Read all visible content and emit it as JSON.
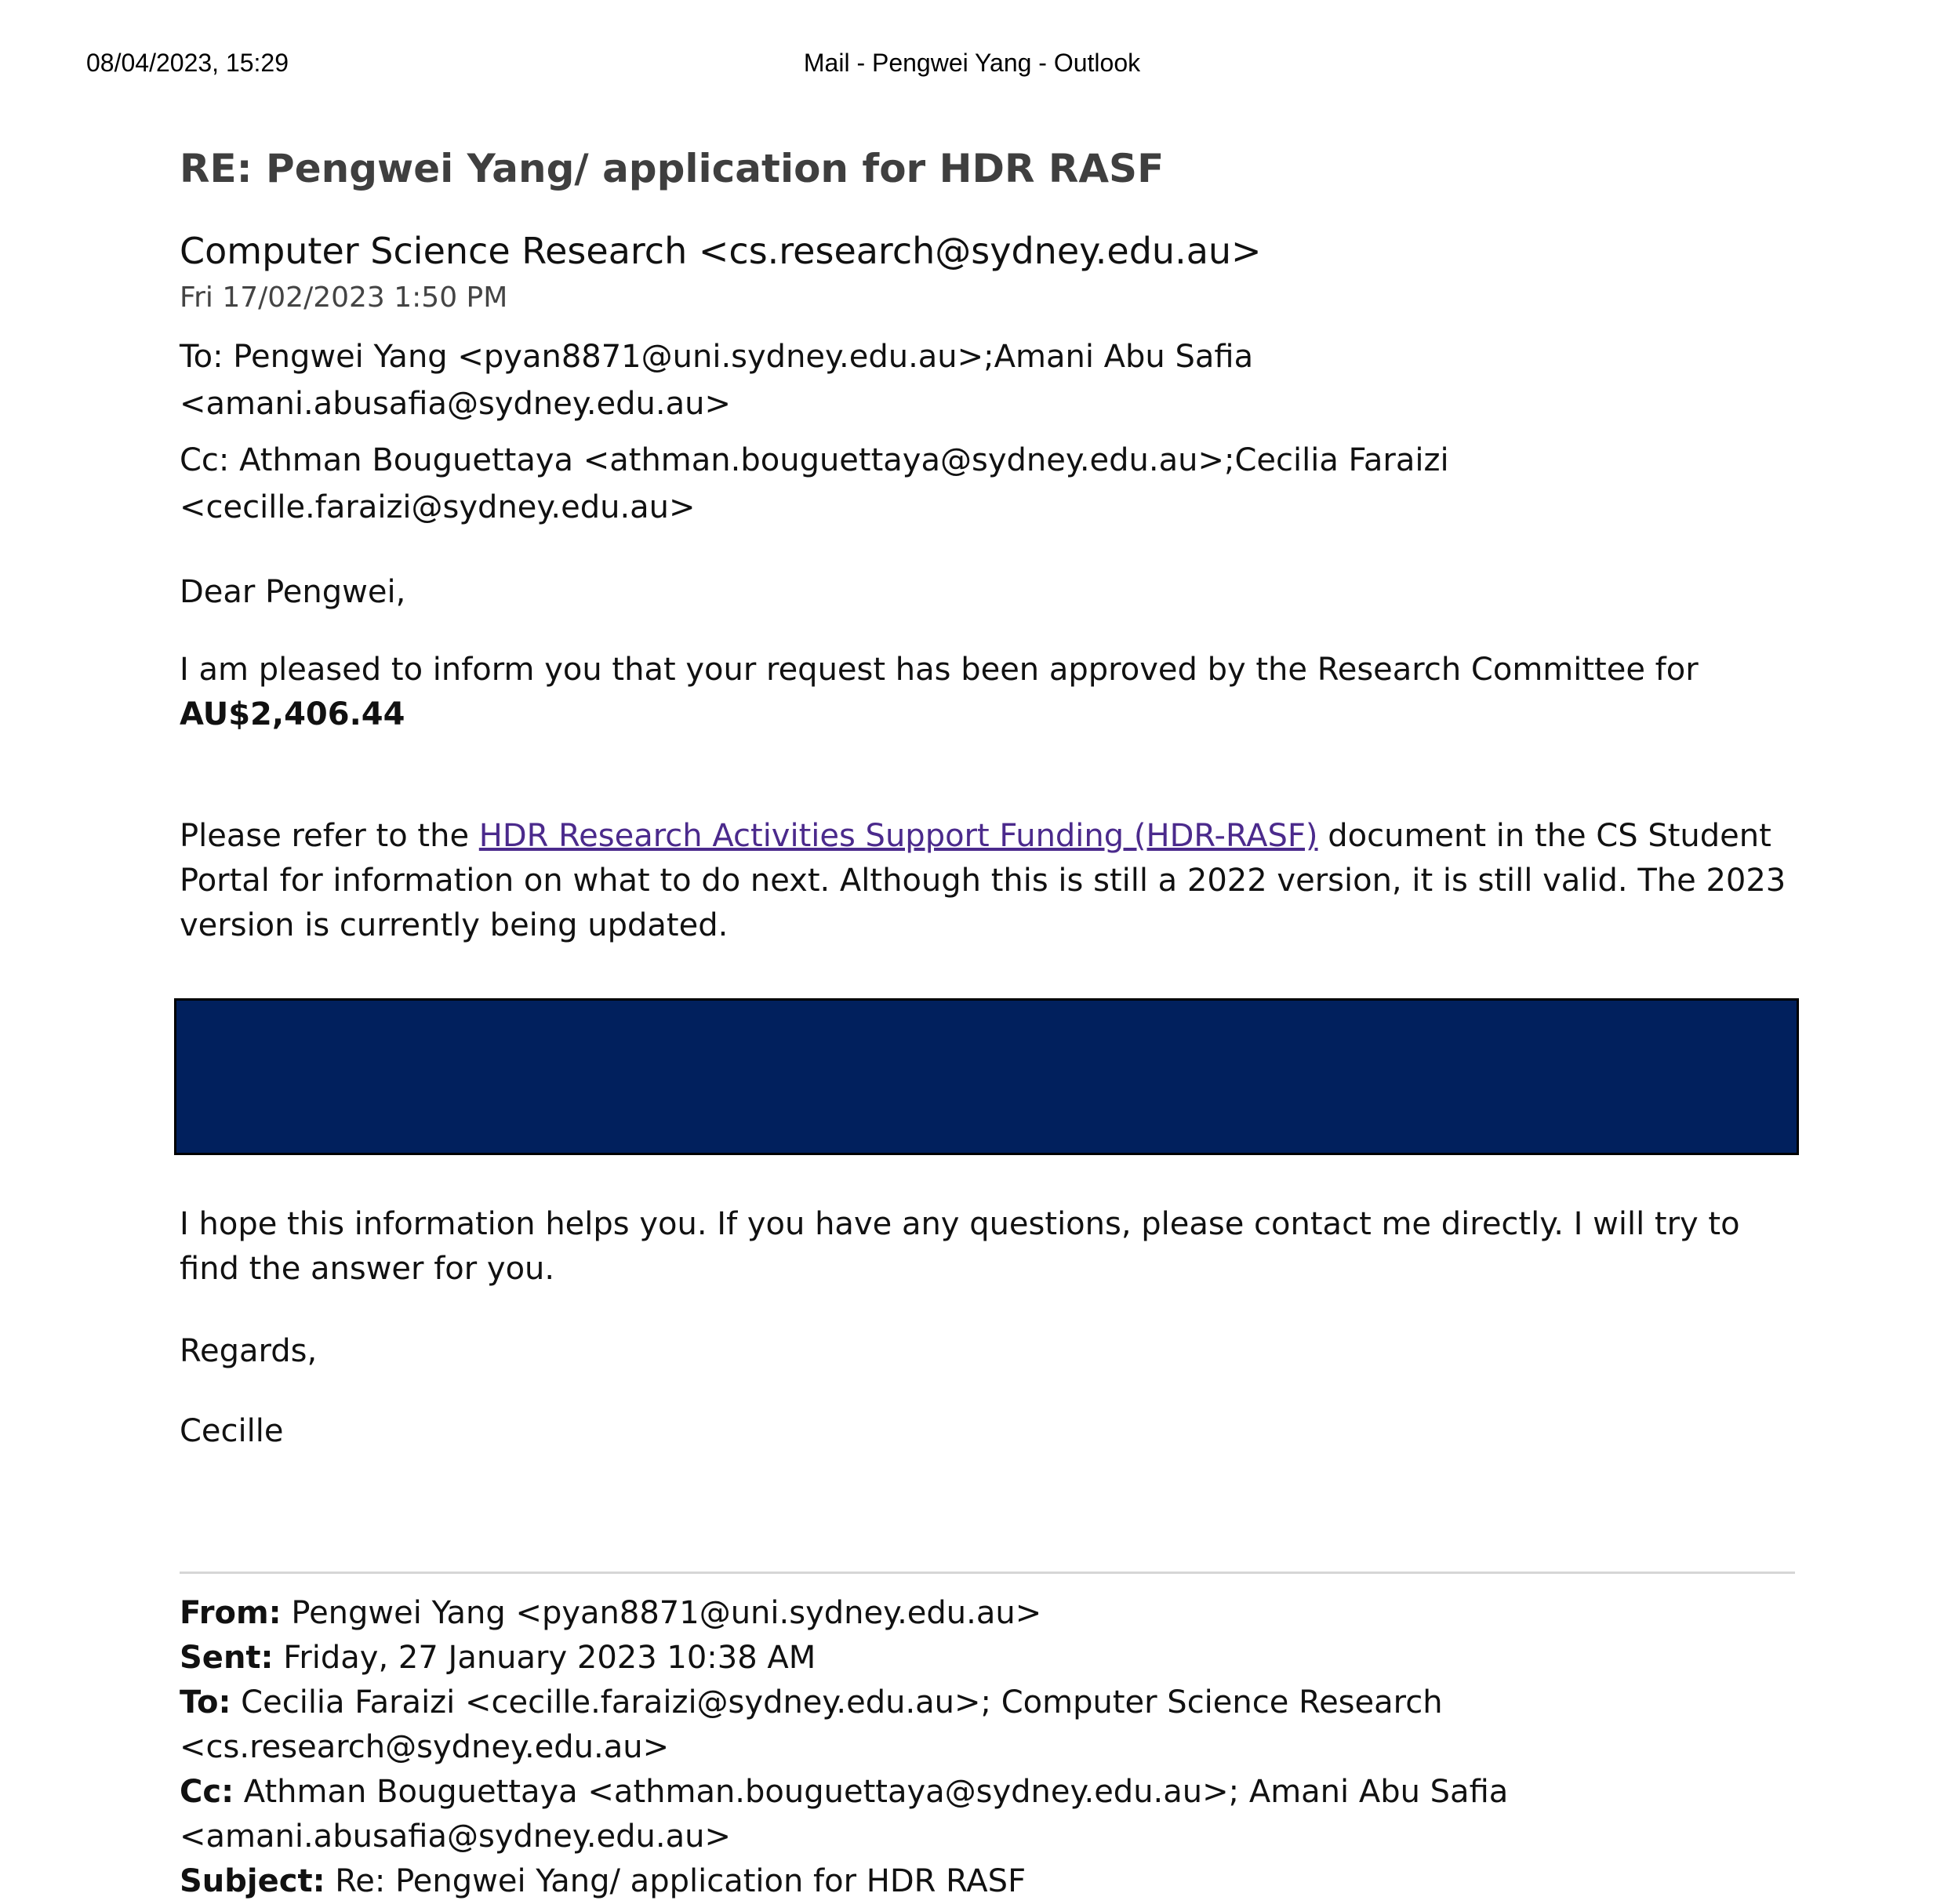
{
  "print_header": {
    "timestamp": "08/04/2023, 15:29",
    "title": "Mail - Pengwei Yang - Outlook"
  },
  "email": {
    "subject": "RE: Pengwei Yang/ application for HDR RASF",
    "sender": "Computer Science Research <cs.research@sydney.edu.au>",
    "date": "Fri 17/02/2023 1:50 PM",
    "to": "To: Pengwei Yang <pyan8871@uni.sydney.edu.au>;Amani Abu Safia <amani.abusafia@sydney.edu.au>",
    "cc_line1": "Cc: Athman Bouguettaya <athman.bouguettaya@sydney.edu.au>;Cecilia Faraizi",
    "cc_line2": "<cecille.faraizi@sydney.edu.au>",
    "greeting": "Dear Pengwei,",
    "para1_text": "I am pleased to inform you that your request has been approved by the Research Committee for ",
    "para1_amount": "AU$2,406.44",
    "para2_pre": "Please refer to the ",
    "para2_link": "HDR Research Activities Support Funding (HDR-RASF)",
    "para2_post": " document in the CS Student Portal for information on what to do next. Although this is still a 2022 version, it is still valid. The 2023 version is currently being updated.",
    "para3": "I hope this information helps you. If you have any questions, please contact me directly. I will try to find the answer for you.",
    "regards": "Regards,",
    "signoff": "Cecille"
  },
  "quoted": {
    "from_label": "From:",
    "from_value": " Pengwei Yang <pyan8871@uni.sydney.edu.au>",
    "sent_label": "Sent:",
    "sent_value": " Friday, 27 January 2023 10:38 AM",
    "to_label": "To:",
    "to_value": " Cecilia Faraizi <cecille.faraizi@sydney.edu.au>; Computer Science Research <cs.research@sydney.edu.au>",
    "cc_label": "Cc:",
    "cc_value": " Athman Bouguettaya <athman.bouguettaya@sydney.edu.au>; Amani Abu Safia",
    "cc_value2": "<amani.abusafia@sydney.edu.au>",
    "subject_label": "Subject:",
    "subject_value": " Re: Pengwei Yang/ application for HDR RASF"
  }
}
